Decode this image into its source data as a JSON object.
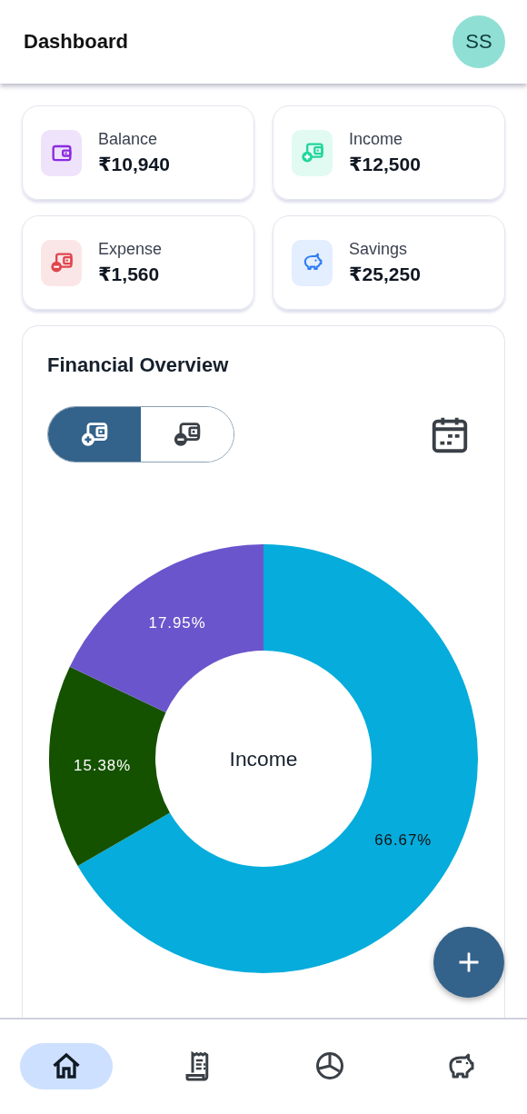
{
  "header": {
    "title": "Dashboard",
    "avatar": "SS"
  },
  "stats": [
    {
      "kind": "wallet",
      "label": "Balance",
      "value": "₹10,940",
      "color": "#8a2be2"
    },
    {
      "kind": "income",
      "label": "Income",
      "value": "₹12,500",
      "color": "#1fd69a"
    },
    {
      "kind": "expense",
      "label": "Expense",
      "value": "₹1,560",
      "color": "#e0454d"
    },
    {
      "kind": "savings",
      "label": "Savings",
      "value": "₹25,250",
      "color": "#2f7cf6"
    }
  ],
  "overview": {
    "title": "Financial Overview",
    "toggle": [
      {
        "kind": "income",
        "selected": true
      },
      {
        "kind": "expense",
        "selected": false
      }
    ],
    "chart_data": {
      "type": "donut",
      "values": [
        66.67,
        15.38,
        17.95
      ],
      "colors": [
        "#05acdc",
        "#145200",
        "#6a55cc"
      ],
      "value_labels": [
        "66.67%",
        "15.38%",
        "17.95%"
      ],
      "annotations": [
        {
          "text": "Income"
        }
      ]
    }
  },
  "nav": [
    {
      "kind": "home",
      "selected": true
    },
    {
      "kind": "receipt",
      "selected": false
    },
    {
      "kind": "chart",
      "selected": false
    },
    {
      "kind": "savings",
      "selected": false
    }
  ]
}
